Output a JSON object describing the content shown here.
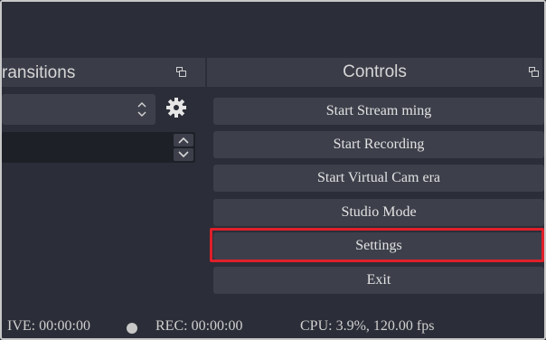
{
  "transitions_panel": {
    "title": "ransitions",
    "undock_icon": "undock-icon",
    "select_arrows_icon": "spin-arrows-icon",
    "settings_icon": "gear-icon",
    "duration_up_icon": "chevron-up-icon",
    "duration_down_icon": "chevron-down-icon"
  },
  "controls_panel": {
    "title": "Controls",
    "undock_icon": "undock-icon",
    "buttons": [
      {
        "label": "Start Stream ming"
      },
      {
        "label": "Start Recording"
      },
      {
        "label": "Start Virtual Cam era"
      },
      {
        "label": "Studio Mode"
      },
      {
        "label": "Settings"
      },
      {
        "label": "Exit"
      }
    ],
    "highlight_color": "#e0202a"
  },
  "status_bar": {
    "live": "IVE: 00:00:00",
    "rec": "REC: 00:00:00",
    "cpu": "CPU: 3.9%, 120.00 fps"
  }
}
